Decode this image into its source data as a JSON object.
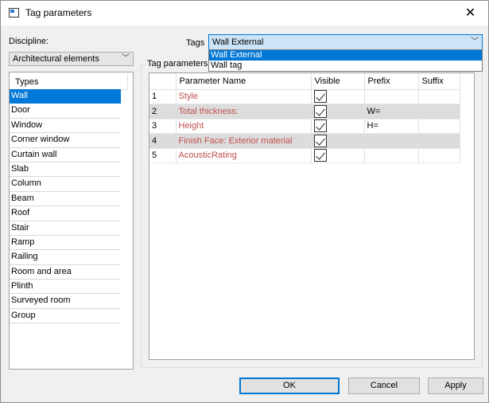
{
  "window": {
    "title": "Tag parameters",
    "close_glyph": "✕"
  },
  "discipline": {
    "label": "Discipline:",
    "value": "Architectural elements"
  },
  "tags": {
    "label": "Tags",
    "value": "Wall External",
    "options": [
      "Wall External",
      "Wall tag"
    ],
    "selected_index": 0
  },
  "types": {
    "header": "Types",
    "items": [
      "Wall",
      "Door",
      "Window",
      "Corner window",
      "Curtain wall",
      "Slab",
      "Column",
      "Beam",
      "Roof",
      "Stair",
      "Ramp",
      "Railing",
      "Room and area",
      "Plinth",
      "Surveyed room",
      "Group"
    ],
    "selected_index": 0
  },
  "tag_parameters": {
    "group_label": "Tag parameters",
    "columns": [
      "",
      "Parameter Name",
      "Visible",
      "Prefix",
      "Suffix"
    ],
    "rows": [
      {
        "index": "1",
        "name": "Style",
        "visible": true,
        "prefix": "",
        "suffix": ""
      },
      {
        "index": "2",
        "name": "Total thickness:",
        "visible": true,
        "prefix": "W=",
        "suffix": ""
      },
      {
        "index": "3",
        "name": "Height",
        "visible": true,
        "prefix": "H=",
        "suffix": ""
      },
      {
        "index": "4",
        "name": "Finish Face: Exterior material",
        "visible": true,
        "prefix": "",
        "suffix": ""
      },
      {
        "index": "5",
        "name": "AcousticRating",
        "visible": true,
        "prefix": "",
        "suffix": ""
      }
    ]
  },
  "buttons": {
    "ok": "OK",
    "cancel": "Cancel",
    "apply": "Apply"
  },
  "colors": {
    "selection": "#0078d7",
    "parameter_text": "#c0504d",
    "alt_row": "#dcdcdc"
  }
}
